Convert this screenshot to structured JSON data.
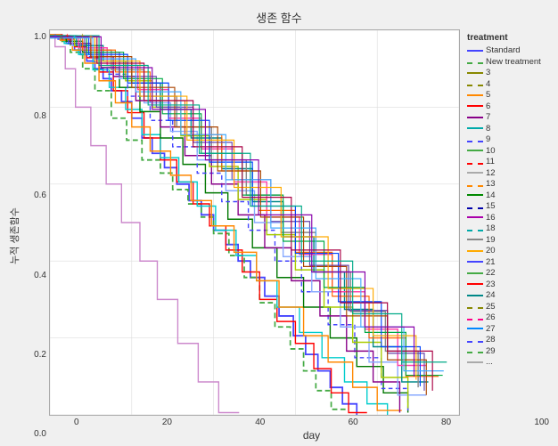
{
  "title": "생존 함수",
  "yLabel": "누적 생존함수",
  "xLabel": "day",
  "xAxisValues": [
    "0",
    "20",
    "40",
    "60",
    "80",
    "100"
  ],
  "yAxisValues": [
    "1.0",
    "0.8",
    "0.6",
    "0.4",
    "0.2",
    "0.0"
  ],
  "legend": {
    "title": "treatment",
    "items": [
      {
        "label": "Standard",
        "color": "#4444ff",
        "dash": "solid"
      },
      {
        "label": "New treatment",
        "color": "#44aa44",
        "dash": "dashed"
      },
      {
        "label": "3",
        "color": "#888800",
        "dash": "solid"
      },
      {
        "label": "4",
        "color": "#888800",
        "dash": "dashed"
      },
      {
        "label": "5",
        "color": "#ff8800",
        "dash": "solid"
      },
      {
        "label": "6",
        "color": "#ff0000",
        "dash": "solid"
      },
      {
        "label": "7",
        "color": "#880088",
        "dash": "solid"
      },
      {
        "label": "8",
        "color": "#00aaaa",
        "dash": "solid"
      },
      {
        "label": "9",
        "color": "#4444ff",
        "dash": "dashed"
      },
      {
        "label": "10",
        "color": "#44aa44",
        "dash": "solid"
      },
      {
        "label": "11",
        "color": "#ff0000",
        "dash": "dashed"
      },
      {
        "label": "12",
        "color": "#aaaaaa",
        "dash": "solid"
      },
      {
        "label": "13",
        "color": "#ff8800",
        "dash": "dashed"
      },
      {
        "label": "14",
        "color": "#008800",
        "dash": "solid"
      },
      {
        "label": "15",
        "color": "#0000aa",
        "dash": "dashed"
      },
      {
        "label": "16",
        "color": "#aa00aa",
        "dash": "solid"
      },
      {
        "label": "18",
        "color": "#00aaaa",
        "dash": "dashed"
      },
      {
        "label": "19",
        "color": "#888888",
        "dash": "solid"
      },
      {
        "label": "20",
        "color": "#ffaa00",
        "dash": "solid"
      },
      {
        "label": "21",
        "color": "#4444ff",
        "dash": "solid"
      },
      {
        "label": "22",
        "color": "#44aa44",
        "dash": "solid"
      },
      {
        "label": "23",
        "color": "#ff0000",
        "dash": "solid"
      },
      {
        "label": "24",
        "color": "#008888",
        "dash": "solid"
      },
      {
        "label": "25",
        "color": "#888800",
        "dash": "dashed"
      },
      {
        "label": "26",
        "color": "#ff0088",
        "dash": "dashed"
      },
      {
        "label": "27",
        "color": "#0088ff",
        "dash": "solid"
      },
      {
        "label": "28",
        "color": "#4444ff",
        "dash": "dashed"
      },
      {
        "label": "29",
        "color": "#44aa44",
        "dash": "dashed"
      },
      {
        "label": "...",
        "color": "#aaaaaa",
        "dash": "solid"
      }
    ]
  }
}
